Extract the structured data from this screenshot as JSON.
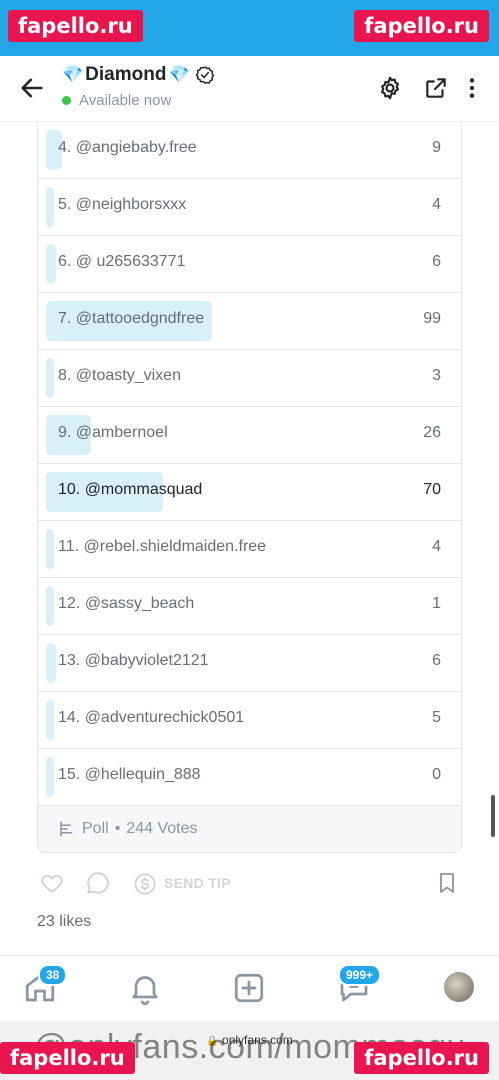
{
  "watermarks": {
    "top_left": "fapello.ru",
    "top_right": "fapello.ru",
    "bottom_left": "fapello.ru",
    "bottom_right": "fapello.ru",
    "overlay_text": "@onlyfans.com/mommasqu"
  },
  "header": {
    "title": "Diamond",
    "title_emoji": "💎",
    "status": "Available now"
  },
  "poll": {
    "options": [
      {
        "label": "4. @angiebaby.free",
        "count": "9",
        "fraction": 0.04
      },
      {
        "label": "5. @neighborsxxx",
        "count": "4",
        "fraction": 0.018
      },
      {
        "label": "6. @ u265633771",
        "count": "6",
        "fraction": 0.025
      },
      {
        "label": "7. @tattooedgndfree",
        "count": "99",
        "fraction": 0.41
      },
      {
        "label": "8. @toasty_vixen",
        "count": "3",
        "fraction": 0.012
      },
      {
        "label": "9. @ambernoel",
        "count": "26",
        "fraction": 0.11
      },
      {
        "label": "10. @mommasquad",
        "count": "70",
        "fraction": 0.29
      },
      {
        "label": "11. @rebel.shieldmaiden.free",
        "count": "4",
        "fraction": 0.018
      },
      {
        "label": "12. @sassy_beach",
        "count": "1",
        "fraction": 0.006
      },
      {
        "label": "13. @babyviolet2121",
        "count": "6",
        "fraction": 0.025
      },
      {
        "label": "14. @adventurechick0501",
        "count": "5",
        "fraction": 0.02
      },
      {
        "label": "15. @hellequin_888",
        "count": "0",
        "fraction": 0.0
      }
    ],
    "footer_label": "Poll",
    "footer_sep": "•",
    "footer_votes": "244 Votes"
  },
  "actions": {
    "tip_label": "SEND TIP",
    "likes": "23 likes"
  },
  "nav": {
    "home_badge": "38",
    "messages_badge": "999+"
  },
  "url": "onlyfans.com",
  "colors": {
    "accent": "#22a6e8",
    "bar_fill": "#d9f0fb",
    "online": "#3dc24f",
    "watermark": "#e8154f"
  }
}
